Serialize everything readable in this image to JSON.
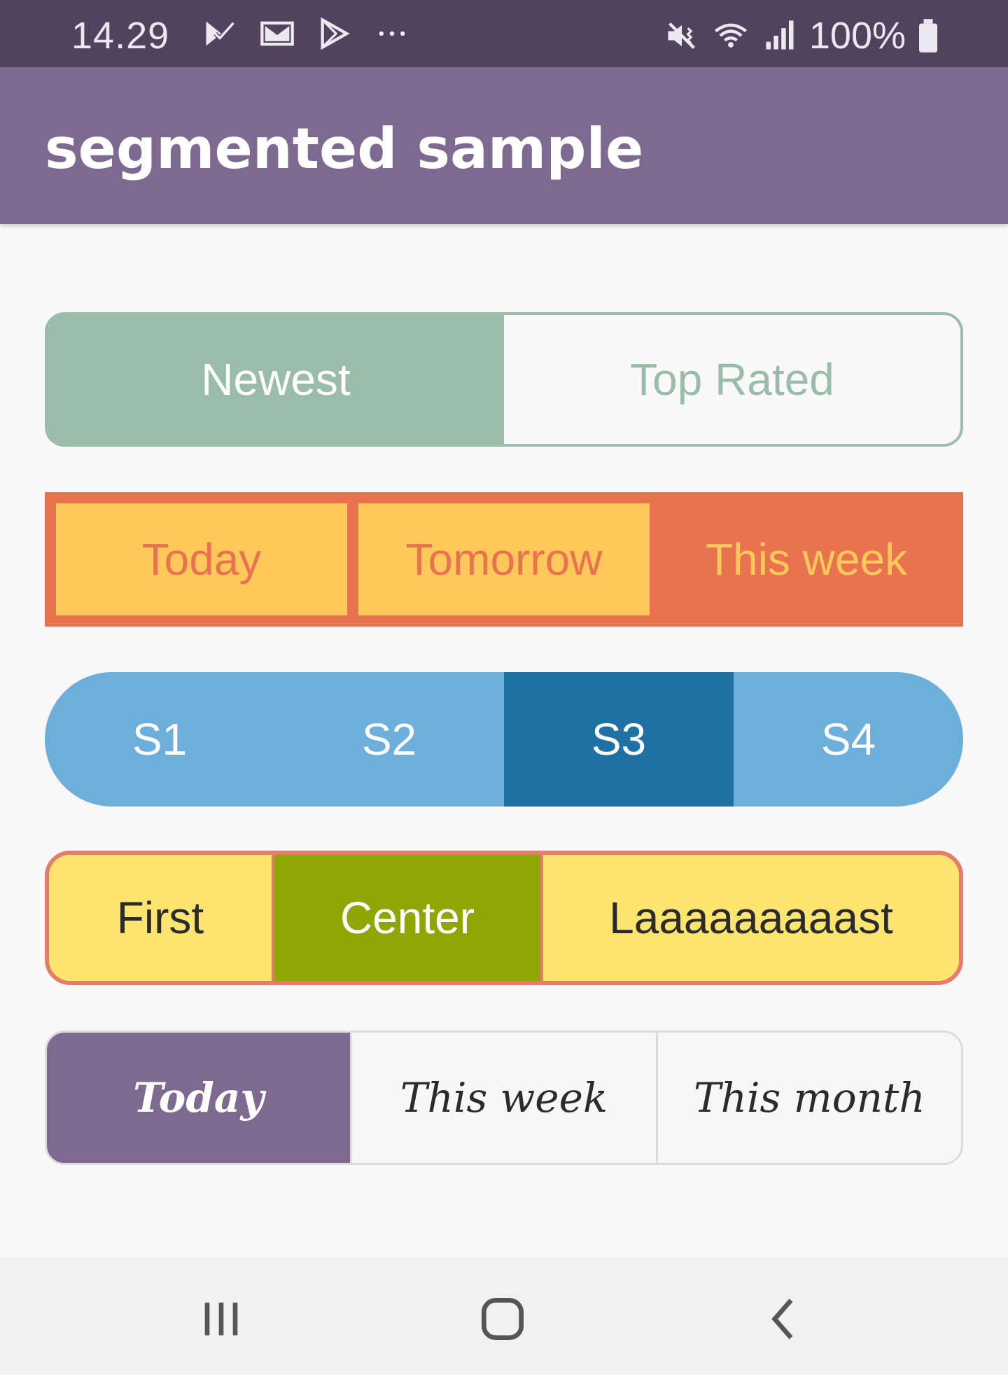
{
  "status_bar": {
    "time": "14.29",
    "left_icons": [
      "play-store-check-icon",
      "gmail-icon",
      "play-icon",
      "more-dots-icon"
    ],
    "right_icons": [
      "mute-vibrate-icon",
      "wifi-icon",
      "signal-icon",
      "battery-icon"
    ],
    "battery": "100%"
  },
  "app_bar": {
    "title": "segmented sample"
  },
  "segments": [
    {
      "buttons": [
        "Newest",
        "Top Rated"
      ],
      "selected": 0,
      "colors": {
        "tint": "#9abca8"
      }
    },
    {
      "buttons": [
        "Today",
        "Tomorrow",
        "This week"
      ],
      "selected": 2,
      "colors": {
        "tint": "#ea734f",
        "fill": "#fec85a"
      }
    },
    {
      "buttons": [
        "S1",
        "S2",
        "S3",
        "S4"
      ],
      "selected": 2,
      "colors": {
        "tint": "#6eaedb",
        "active": "#1f71a4"
      }
    },
    {
      "buttons": [
        "First",
        "Center",
        "Laaaaaaaaast"
      ],
      "selected": 1,
      "colors": {
        "border": "#e47d6c",
        "fill": "#fee56f",
        "active": "#8fa704"
      }
    },
    {
      "buttons": [
        "Today",
        "This week",
        "This month"
      ],
      "selected": 0,
      "colors": {
        "active": "#7e6991",
        "border": "#dcdcdc"
      }
    }
  ],
  "nav_bar": {
    "icons": [
      "recent-apps-icon",
      "home-icon",
      "back-icon"
    ]
  }
}
